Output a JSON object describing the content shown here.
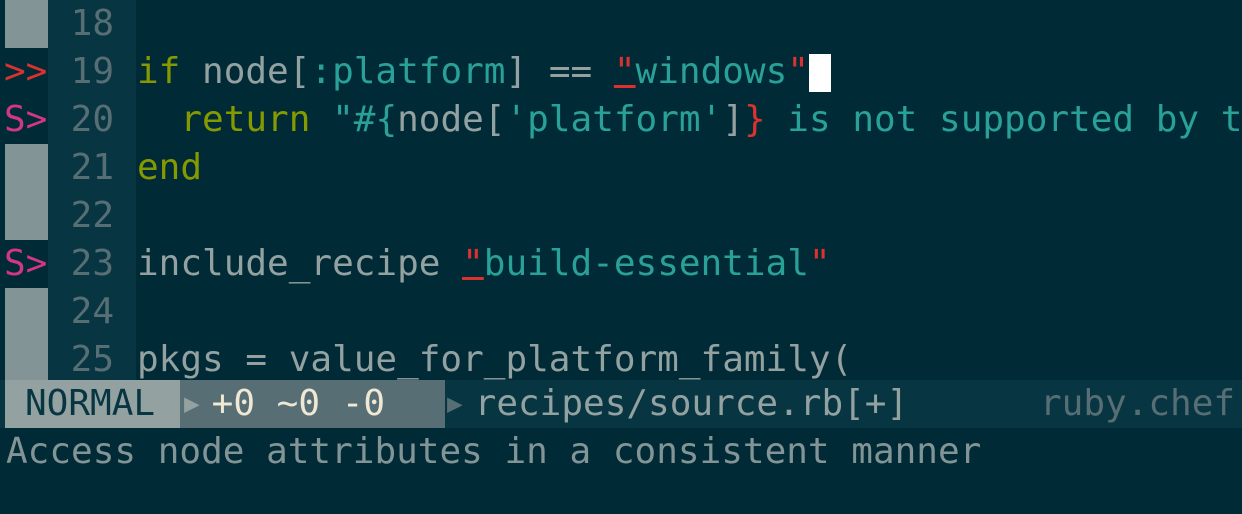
{
  "editor": {
    "lines": [
      {
        "num": "18",
        "sign": ""
      },
      {
        "num": "19",
        "sign": ">>"
      },
      {
        "num": "20",
        "sign": "S>"
      },
      {
        "num": "21",
        "sign": ""
      },
      {
        "num": "22",
        "sign": ""
      },
      {
        "num": "23",
        "sign": "S>"
      },
      {
        "num": "24",
        "sign": ""
      },
      {
        "num": "25",
        "sign": ""
      }
    ],
    "code": {
      "l19_if": "if",
      "l19_node": " node[",
      "l19_sym": ":platform",
      "l19_rest": "] == ",
      "l19_q1": "\"",
      "l19_str": "windows",
      "l19_q2": "\"",
      "l20_indent": "  ",
      "l20_return": "return",
      "l20_sp": " ",
      "l20_q1": "\"#{",
      "l20_node": "node[",
      "l20_sq": "'platform'",
      "l20_close": "]",
      "l20_brace": "}",
      "l20_tail": " is not supported by t",
      "l21_end": "end",
      "l23_inc": "include_recipe ",
      "l23_q1": "\"",
      "l23_str": "build-essential",
      "l23_q2": "\"",
      "l25": "pkgs = value_for_platform_family("
    }
  },
  "status": {
    "mode": "NORMAL",
    "hunks": "+0 ~0 -0",
    "file": "recipes/source.rb[+]",
    "filetype": "ruby.chef"
  },
  "cmdline": "Access node attributes in a consistent manner",
  "colors": {
    "background": "#002b36",
    "gutter": "#073642",
    "keyword": "#859900",
    "string": "#2aa198",
    "error": "#dc322f",
    "style_sign": "#d33682"
  }
}
